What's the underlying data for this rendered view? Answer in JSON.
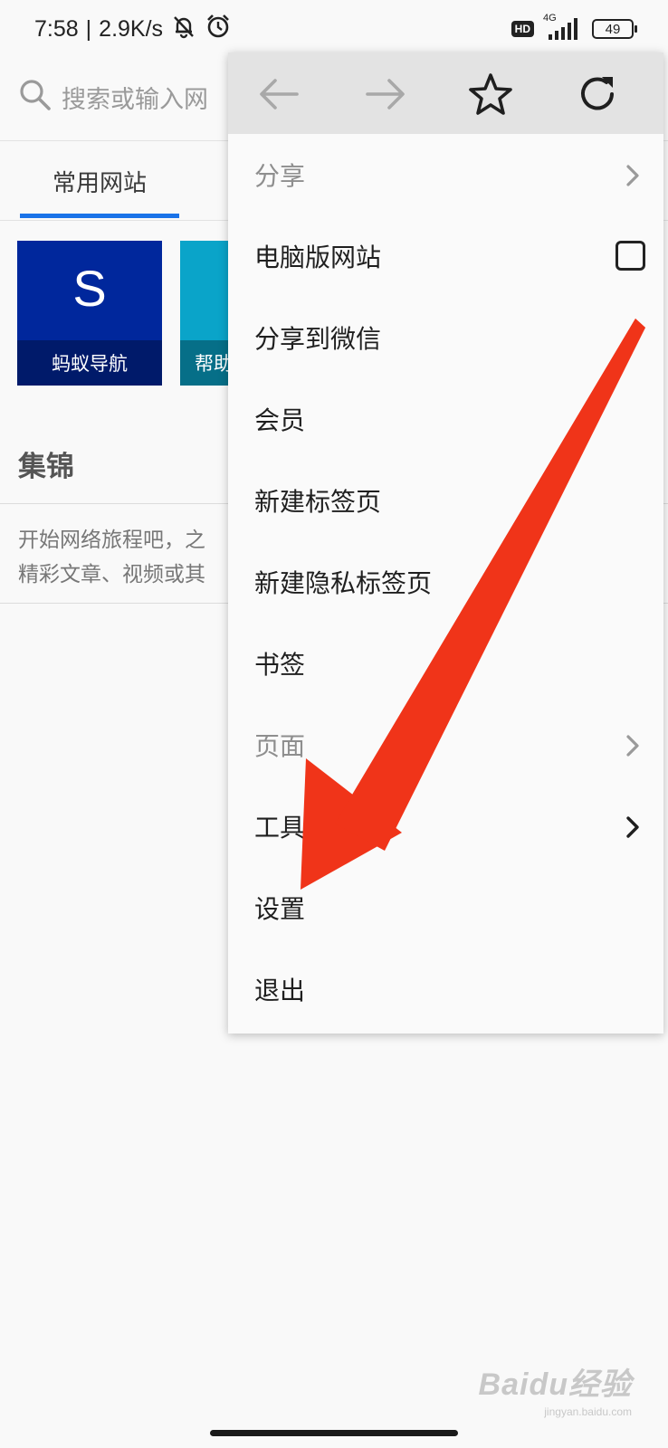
{
  "status_bar": {
    "time": "7:58",
    "separator": "|",
    "speed": "2.9K/s",
    "hd": "HD",
    "network": "4G",
    "battery": "49"
  },
  "search": {
    "placeholder": "搜索或输入网"
  },
  "tabs": {
    "active": "常用网站"
  },
  "tiles": [
    {
      "letter": "S",
      "label": "蚂蚁导航",
      "color": "#00279c"
    },
    {
      "letter": "",
      "label": "帮助",
      "color": "#0aa4c9"
    }
  ],
  "collection": {
    "title": "集锦",
    "line1": "开始网络旅程吧，之",
    "line2": "精彩文章、视频或其"
  },
  "menu": {
    "toolbar_icons": [
      "back-arrow-icon",
      "forward-arrow-icon",
      "star-icon",
      "refresh-icon"
    ],
    "items": [
      {
        "label": "分享",
        "enabled": false,
        "trailing": "chevron"
      },
      {
        "label": "电脑版网站",
        "enabled": true,
        "trailing": "checkbox",
        "checked": false
      },
      {
        "label": "分享到微信",
        "enabled": true,
        "trailing": ""
      },
      {
        "label": "会员",
        "enabled": true,
        "trailing": ""
      },
      {
        "label": "新建标签页",
        "enabled": true,
        "trailing": ""
      },
      {
        "label": "新建隐私标签页",
        "enabled": true,
        "trailing": ""
      },
      {
        "label": "书签",
        "enabled": true,
        "trailing": ""
      },
      {
        "label": "页面",
        "enabled": false,
        "trailing": "chevron"
      },
      {
        "label": "工具",
        "enabled": true,
        "trailing": "chevron"
      },
      {
        "label": "设置",
        "enabled": true,
        "trailing": ""
      },
      {
        "label": "退出",
        "enabled": true,
        "trailing": ""
      }
    ]
  },
  "annotation": {
    "arrow_color": "#f03419"
  },
  "watermark": {
    "main": "Baidu经验",
    "sub": "jingyan.baidu.com"
  }
}
